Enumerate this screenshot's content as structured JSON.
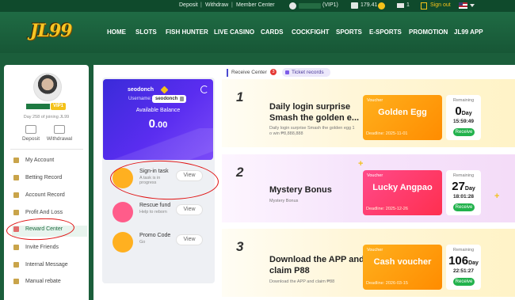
{
  "topbar": {
    "deposit": "Deposit",
    "sep1": "|",
    "withdraw": "Withdraw",
    "sep2": "|",
    "member_center": "Member Center",
    "vip_tag": "(VIP1)",
    "balance": "179.41",
    "messages": "1",
    "sign_out": "Sign out"
  },
  "header": {
    "logo": "JL99",
    "nav": [
      "HOME",
      "SLOTS",
      "FISH HUNTER",
      "LIVE CASINO",
      "CARDS",
      "COCKFIGHT",
      "SPORTS",
      "E-SPORTS",
      "PROMOTION",
      "JL99 APP"
    ]
  },
  "sidebar": {
    "vip": "VIP1",
    "days_text": "Day 258 of joining JL99",
    "deposit": "Deposit",
    "withdrawal": "Withdrawal",
    "menu": [
      "My Account",
      "Betting Record",
      "Account Record",
      "Profit And Loss",
      "Reward Center",
      "Invite Friends",
      "Internal Message",
      "Manual rebate"
    ],
    "active_item": "Reward Center"
  },
  "tabs": {
    "receive_center": "Receive Center",
    "receive_count": "3",
    "ticket_records": "Ticket records"
  },
  "balance_card": {
    "username_display": "seodonch",
    "username_label": "Username:",
    "username_value": "seodonch",
    "available_label": "Available Balance",
    "amount_int": "0",
    "amount_dec": ".00"
  },
  "tasks": [
    {
      "title": "Sign-in task",
      "subtitle": "A task is in progress",
      "button": "View"
    },
    {
      "title": "Rescue fund",
      "subtitle": "Help to reborn",
      "button": "View"
    },
    {
      "title": "Promo Code",
      "subtitle": "Go",
      "button": "View"
    }
  ],
  "rewards": [
    {
      "number": "1",
      "title": "Daily login surprise Smash the golden e...",
      "desc": "Daily login surprise Smash the golden egg 1 o win ₱8,888,888",
      "voucher_label": "Voucher",
      "voucher_name": "Golden Egg",
      "deadline": "Deadline:  2025-11-01",
      "remaining_label": "Remaining",
      "days": "0",
      "day_unit": "Day",
      "time": "15:59:49",
      "button": "Receive"
    },
    {
      "number": "2",
      "title": "Mystery Bonus",
      "desc": "Mystery Bonus",
      "voucher_label": "Voucher",
      "voucher_name": "Lucky Angpao",
      "deadline": "Deadline:  2025-12-26",
      "remaining_label": "Remaining",
      "days": "27",
      "day_unit": "Day",
      "time": "18:01:28",
      "button": "Receive"
    },
    {
      "number": "3",
      "title": "Download the APP and claim P88",
      "desc": "Download the APP and claim ₱88",
      "voucher_label": "Voucher",
      "voucher_name": "Cash voucher",
      "deadline": "Deadline:  2026-03-15",
      "remaining_label": "Remaining",
      "days": "106",
      "day_unit": "Day",
      "time": "22:51:27",
      "button": "Receive"
    }
  ],
  "colors": {
    "brand_green": "#1b5e3b",
    "accent_gold": "#f4c21a",
    "receive_green": "#22b24c",
    "annotation_red": "#e01010"
  }
}
